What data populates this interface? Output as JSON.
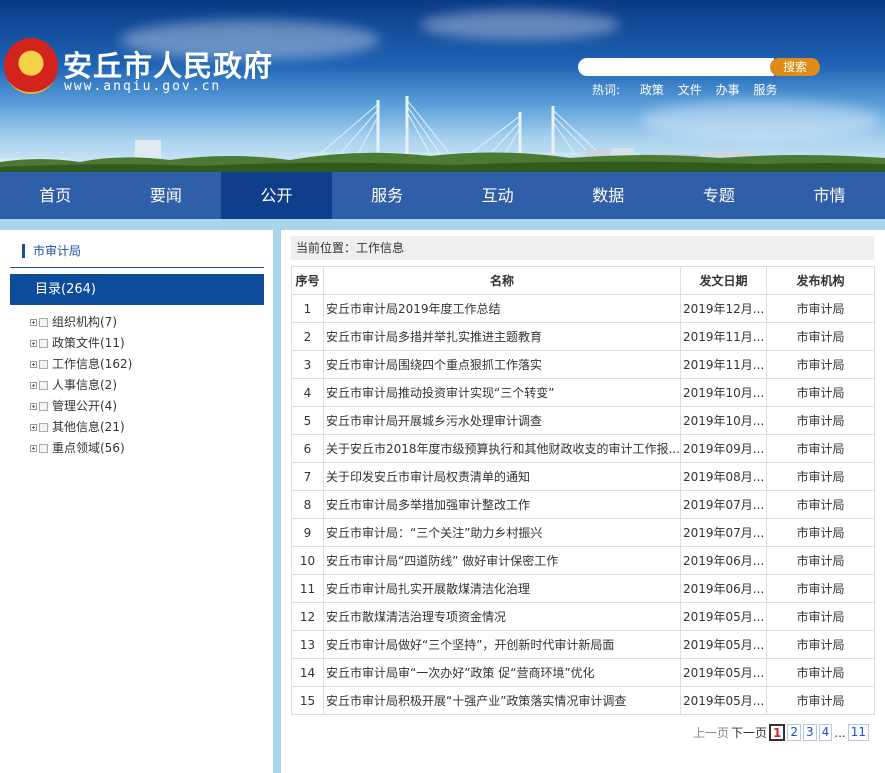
{
  "header": {
    "site_title": "安丘市人民政府",
    "site_url": "www.anqiu.gov.cn",
    "search_placeholder": "",
    "search_button": "搜索",
    "hot_label": "热词:",
    "hot_words": [
      "政策",
      "文件",
      "办事",
      "服务"
    ],
    "colors": {
      "sky_top": "#0a3a86",
      "search_button": "#e08a17"
    }
  },
  "nav": {
    "items": [
      "首页",
      "要闻",
      "公开",
      "服务",
      "互动",
      "数据",
      "专题",
      "市情"
    ],
    "active": "公开"
  },
  "sidebar": {
    "title": "市审计局",
    "catalog": "目录(264)",
    "items": [
      "组织机构(7)",
      "政策文件(11)",
      "工作信息(162)",
      "人事信息(2)",
      "管理公开(4)",
      "其他信息(21)",
      "重点领域(56)"
    ]
  },
  "main": {
    "breadcrumb": "当前位置：工作信息",
    "columns": [
      "序号",
      "名称",
      "发文日期",
      "发布机构"
    ],
    "rows": [
      {
        "no": "1",
        "title": "安丘市审计局2019年度工作总结",
        "date": "2019年12月...",
        "org": "市审计局"
      },
      {
        "no": "2",
        "title": "安丘市审计局多措并举扎实推进主题教育",
        "date": "2019年11月...",
        "org": "市审计局"
      },
      {
        "no": "3",
        "title": "安丘市审计局围绕四个重点狠抓工作落实",
        "date": "2019年11月...",
        "org": "市审计局"
      },
      {
        "no": "4",
        "title": "安丘市审计局推动投资审计实现“三个转变”",
        "date": "2019年10月...",
        "org": "市审计局"
      },
      {
        "no": "5",
        "title": "安丘市审计局开展城乡污水处理审计调查",
        "date": "2019年10月...",
        "org": "市审计局"
      },
      {
        "no": "6",
        "title": "关于安丘市2018年度市级预算执行和其他财政收支的审计工作报...",
        "date": "2019年09月...",
        "org": "市审计局"
      },
      {
        "no": "7",
        "title": "关于印发安丘市审计局权责清单的通知",
        "date": "2019年08月...",
        "org": "市审计局"
      },
      {
        "no": "8",
        "title": "安丘市审计局多举措加强审计整改工作",
        "date": "2019年07月...",
        "org": "市审计局"
      },
      {
        "no": "9",
        "title": "安丘市审计局：“三个关注”助力乡村振兴",
        "date": "2019年07月...",
        "org": "市审计局"
      },
      {
        "no": "10",
        "title": "安丘市审计局“四道防线” 做好审计保密工作",
        "date": "2019年06月...",
        "org": "市审计局"
      },
      {
        "no": "11",
        "title": "安丘市审计局扎实开展散煤清洁化治理",
        "date": "2019年06月...",
        "org": "市审计局"
      },
      {
        "no": "12",
        "title": "安丘市散煤清洁治理专项资金情况",
        "date": "2019年05月...",
        "org": "市审计局"
      },
      {
        "no": "13",
        "title": "安丘市审计局做好“三个坚持”，开创新时代审计新局面",
        "date": "2019年05月...",
        "org": "市审计局"
      },
      {
        "no": "14",
        "title": "安丘市审计局审“一次办好”政策 促“营商环境”优化",
        "date": "2019年05月...",
        "org": "市审计局"
      },
      {
        "no": "15",
        "title": "安丘市审计局积极开展“十强产业”政策落实情况审计调查",
        "date": "2019年05月...",
        "org": "市审计局"
      }
    ]
  },
  "pager": {
    "prev": "上一页",
    "next": "下一页",
    "pages": [
      "1",
      "2",
      "3",
      "4"
    ],
    "current": "1",
    "ellipsis": "...",
    "last": "11"
  }
}
